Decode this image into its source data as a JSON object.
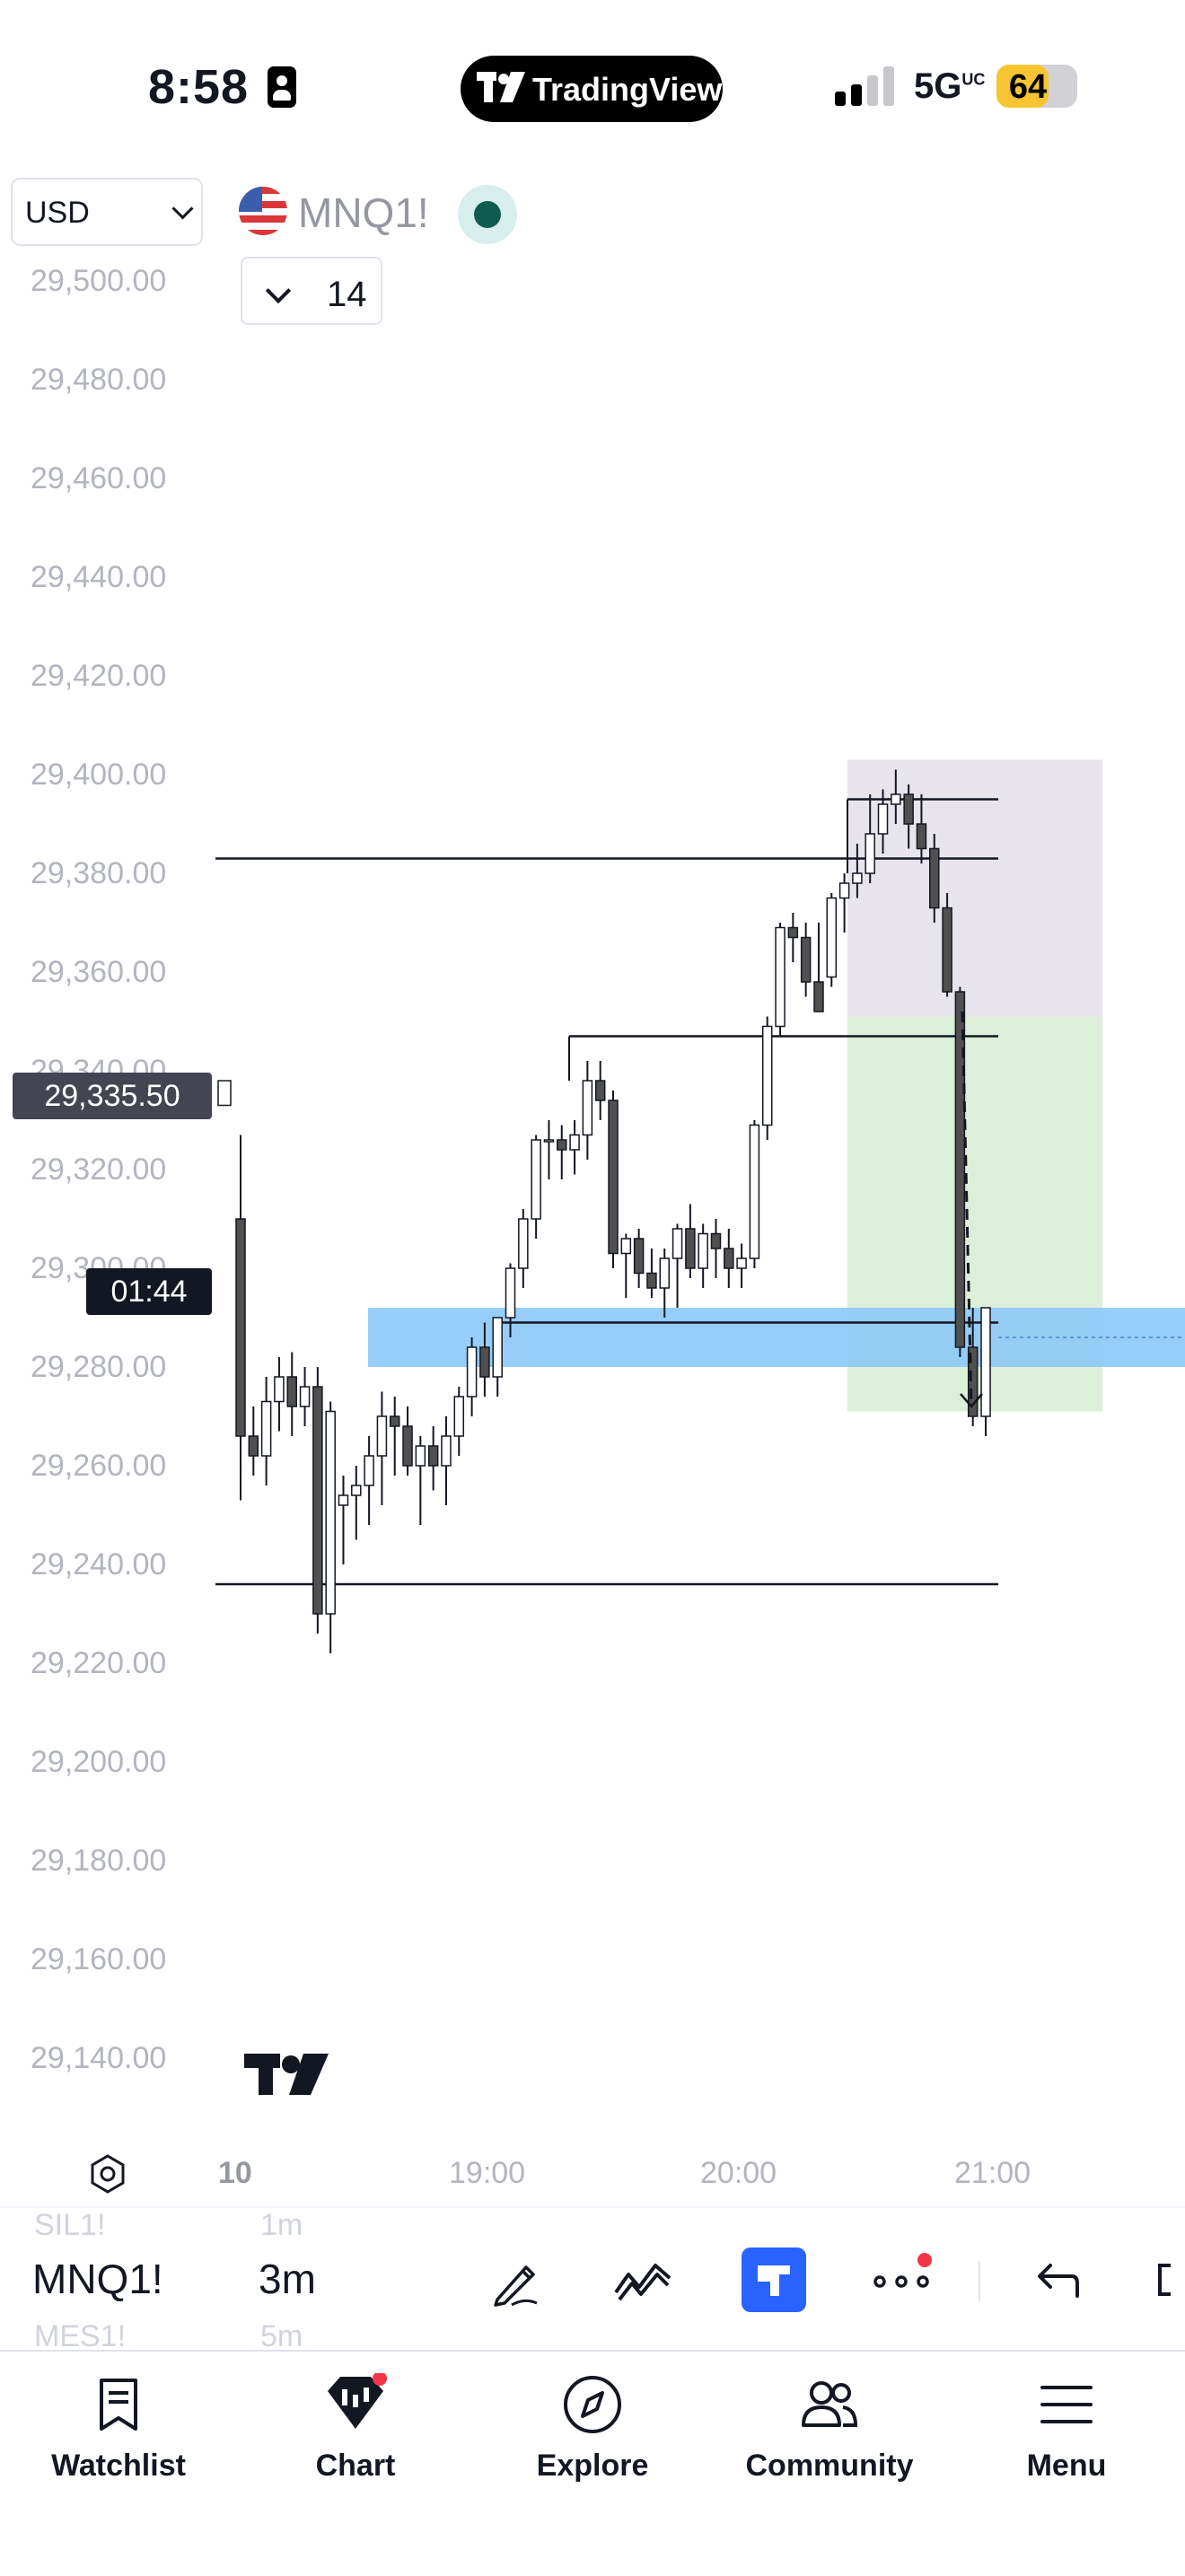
{
  "status_bar": {
    "time": "8:58",
    "network": "5G",
    "network_suffix": "UC",
    "battery": "64"
  },
  "app_badge": "TradingView",
  "header": {
    "currency": "USD",
    "symbol": "MNQ1!",
    "indicator_count": "14"
  },
  "price_axis": {
    "labels": [
      "29,500.00",
      "29,480.00",
      "29,460.00",
      "29,440.00",
      "29,420.00",
      "29,400.00",
      "29,380.00",
      "29,360.00",
      "29,340.00",
      "29,320.00",
      "29,300.00",
      "29,280.00",
      "29,260.00",
      "29,240.00",
      "29,220.00",
      "29,200.00",
      "29,180.00",
      "29,160.00",
      "29,140.00"
    ],
    "current_price": "29,335.50",
    "countdown": "01:44"
  },
  "time_axis": {
    "labels": [
      "10",
      "19:00",
      "20:00",
      "21:00"
    ]
  },
  "toolbar": {
    "symbol": "MNQ1!",
    "interval": "3m",
    "prev_symbol": "SIL1!",
    "next_symbol": "MES1!",
    "prev_interval": "1m",
    "next_interval": "5m"
  },
  "nav": {
    "watchlist": "Watchlist",
    "chart": "Chart",
    "explore": "Explore",
    "community": "Community",
    "menu": "Menu"
  },
  "colors": {
    "accent": "#2962ff",
    "zone_blue": "#90caf9",
    "zone_green": "#dcefd9",
    "zone_gray": "#e8e4ec",
    "notif": "#f23645"
  },
  "chart_data": {
    "type": "candlestick",
    "ylim": [
      29130,
      29510
    ],
    "candles": [
      [
        29310,
        29327,
        29253,
        29266
      ],
      [
        29266,
        29272,
        29258,
        29262
      ],
      [
        29262,
        29278,
        29256,
        29273
      ],
      [
        29273,
        29282,
        29267,
        29278
      ],
      [
        29278,
        29283,
        29266,
        29272
      ],
      [
        29272,
        29280,
        29268,
        29276
      ],
      [
        29276,
        29280,
        29226,
        29230
      ],
      [
        29230,
        29273,
        29222,
        29271
      ],
      [
        29252,
        29258,
        29240,
        29254
      ],
      [
        29254,
        29260,
        29245,
        29256
      ],
      [
        29256,
        29266,
        29248,
        29262
      ],
      [
        29262,
        29275,
        29252,
        29270
      ],
      [
        29270,
        29274,
        29258,
        29268
      ],
      [
        29268,
        29272,
        29258,
        29260
      ],
      [
        29260,
        29266,
        29248,
        29264
      ],
      [
        29264,
        29268,
        29255,
        29260
      ],
      [
        29260,
        29270,
        29252,
        29266
      ],
      [
        29266,
        29276,
        29262,
        29274
      ],
      [
        29274,
        29286,
        29270,
        29284
      ],
      [
        29284,
        29289,
        29274,
        29278
      ],
      [
        29278,
        29290,
        29274,
        29290
      ],
      [
        29290,
        29301,
        29286,
        29300
      ],
      [
        29300,
        29312,
        29296,
        29310
      ],
      [
        29310,
        29327,
        29306,
        29326
      ],
      [
        29326,
        29330,
        29318,
        29326
      ],
      [
        29326,
        29329,
        29318,
        29324
      ],
      [
        29324,
        29330,
        29319,
        29327
      ],
      [
        29327,
        29342,
        29322,
        29338
      ],
      [
        29338,
        29342,
        29330,
        29334
      ],
      [
        29334,
        29336,
        29300,
        29303
      ],
      [
        29303,
        29307,
        29294,
        29306
      ],
      [
        29306,
        29308,
        29296,
        29299
      ],
      [
        29299,
        29304,
        29294,
        29296
      ],
      [
        29296,
        29304,
        29290,
        29302
      ],
      [
        29302,
        29309,
        29292,
        29308
      ],
      [
        29308,
        29313,
        29298,
        29300
      ],
      [
        29300,
        29309,
        29296,
        29307
      ],
      [
        29307,
        29310,
        29298,
        29304
      ],
      [
        29304,
        29308,
        29296,
        29300
      ],
      [
        29300,
        29305,
        29296,
        29302
      ],
      [
        29302,
        29330,
        29300,
        29329
      ],
      [
        29329,
        29351,
        29326,
        29349
      ],
      [
        29349,
        29370,
        29347,
        29369
      ],
      [
        29369,
        29372,
        29362,
        29367
      ],
      [
        29367,
        29370,
        29355,
        29358
      ],
      [
        29358,
        29370,
        29352,
        29352
      ],
      [
        29359,
        29376,
        29357,
        29375
      ],
      [
        29375,
        29380,
        29368,
        29378
      ],
      [
        29378,
        29386,
        29375,
        29380
      ],
      [
        29380,
        29396,
        29378,
        29388
      ],
      [
        29388,
        29397,
        29384,
        29394
      ],
      [
        29394,
        29401,
        29390,
        29396
      ],
      [
        29396,
        29398,
        29385,
        29390
      ],
      [
        29390,
        29396,
        29382,
        29385
      ],
      [
        29385,
        29388,
        29370,
        29373
      ],
      [
        29373,
        29376,
        29355,
        29356
      ],
      [
        29356,
        29357,
        29282,
        29284
      ],
      [
        29284,
        29292,
        29268,
        29270
      ],
      [
        29270,
        29292,
        29266,
        29292
      ]
    ],
    "horizontal_lines": [
      29383,
      29347,
      29236,
      29395
    ],
    "zones": [
      {
        "name": "supply",
        "top": 29403,
        "bottom": 29351
      },
      {
        "name": "target",
        "top": 29351,
        "bottom": 29271
      },
      {
        "name": "demand",
        "top": 29292,
        "bottom": 29280
      }
    ]
  }
}
